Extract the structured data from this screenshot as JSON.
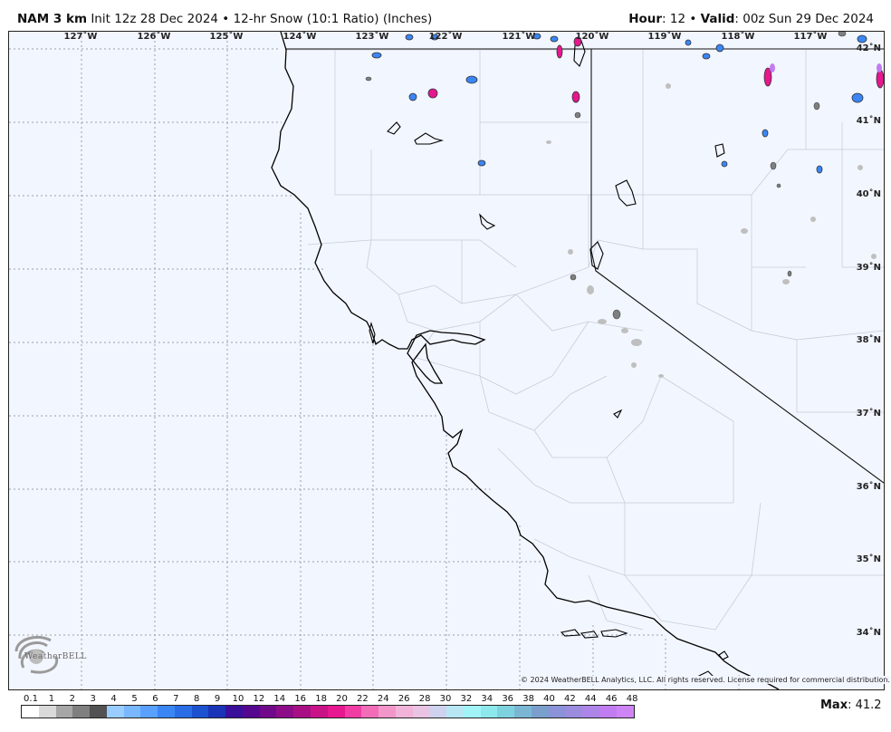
{
  "header": {
    "model": "NAM 3 km",
    "init": "Init 12z 28 Dec 2024",
    "separator": "•",
    "product": "12-hr Snow (10:1 Ratio) (Inches)",
    "hour_label": "Hour",
    "hour_value": ": 12",
    "valid_label": "Valid",
    "valid_value": ": 00z Sun 29 Dec 2024"
  },
  "longitudes": [
    "127˚W",
    "126˚W",
    "125˚W",
    "124˚W",
    "123˚W",
    "122˚W",
    "121˚W",
    "120˚W",
    "119˚W",
    "118˚W",
    "117˚W"
  ],
  "latitudes": [
    "42˚N",
    "41˚N",
    "40˚N",
    "39˚N",
    "38˚N",
    "37˚N",
    "36˚N",
    "35˚N",
    "34˚N"
  ],
  "copyright": "© 2024 WeatherBELL Analytics, LLC. All rights reserved. License required for commercial distribution.",
  "logo_text": "WeatherBELL",
  "legend": {
    "ticks": [
      "0.1",
      "1",
      "2",
      "3",
      "4",
      "5",
      "6",
      "7",
      "8",
      "9",
      "10",
      "12",
      "14",
      "16",
      "18",
      "20",
      "22",
      "24",
      "26",
      "28",
      "30",
      "32",
      "34",
      "36",
      "38",
      "40",
      "42",
      "44",
      "46",
      "48"
    ],
    "colors": [
      "#ffffff",
      "#d9d9d9",
      "#a6a6a6",
      "#7f7f7f",
      "#525252",
      "#99ccff",
      "#79b7ff",
      "#5aa0ff",
      "#3a86f5",
      "#2a6de6",
      "#1c52cf",
      "#1a34b8",
      "#3a0f9a",
      "#55088f",
      "#700a8a",
      "#8c0d87",
      "#a80f85",
      "#c91288",
      "#e6178f",
      "#f03ca3",
      "#f26cb8",
      "#f296c9",
      "#f2b3d8",
      "#e9c3e3",
      "#cfd2ee",
      "#b6e7f2",
      "#a1f3f5",
      "#8de8ec",
      "#7ed1de",
      "#7ab6d4",
      "#7b9fcd",
      "#8b92d8",
      "#9b8ce0",
      "#ad84e8",
      "#c07cf0",
      "#cf84f5"
    ]
  },
  "max": {
    "label": "Max",
    "value": ": 41.2"
  },
  "colors": {
    "background": "#f2f6fe",
    "coast": "#000000",
    "county": "#c9cdd6",
    "grid": "#9aa0aa"
  }
}
